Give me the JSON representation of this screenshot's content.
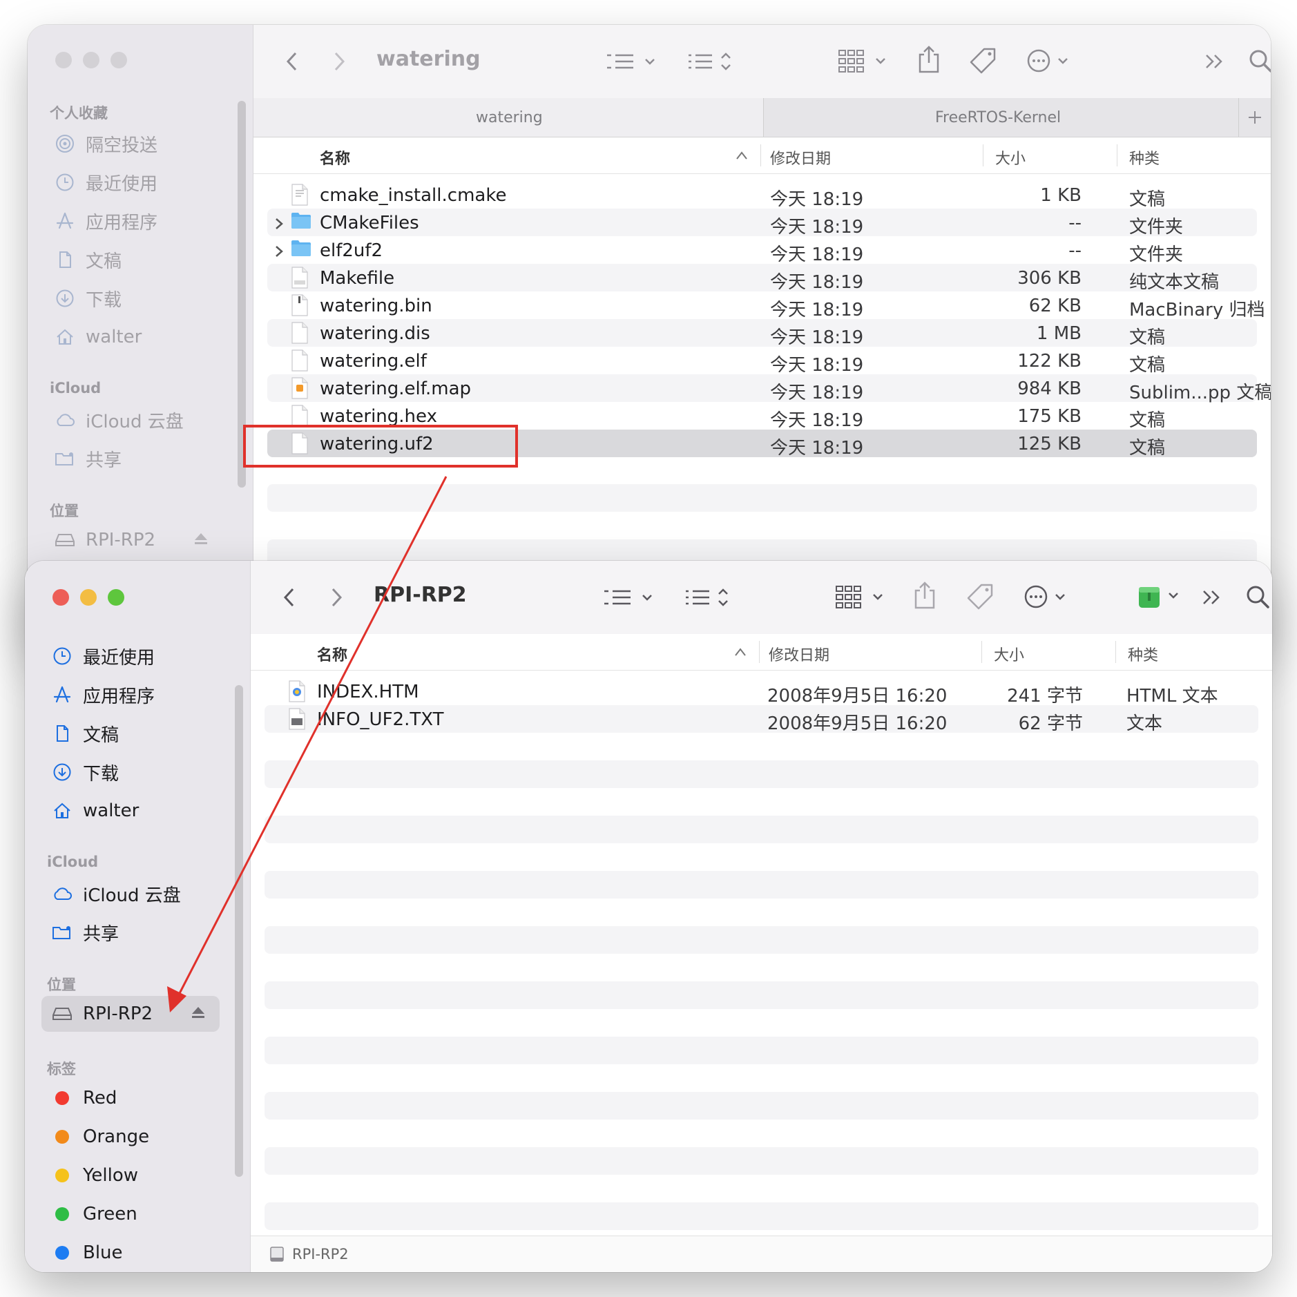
{
  "back_window": {
    "title": "watering",
    "sidebar": {
      "favorites_title": "个人收藏",
      "favorites": [
        {
          "icon": "airdrop-icon",
          "label": "隔空投送"
        },
        {
          "icon": "clock-icon",
          "label": "最近使用"
        },
        {
          "icon": "apps-icon",
          "label": "应用程序"
        },
        {
          "icon": "document-icon",
          "label": "文稿"
        },
        {
          "icon": "download-icon",
          "label": "下载"
        },
        {
          "icon": "home-icon",
          "label": "walter"
        }
      ],
      "icloud_title": "iCloud",
      "icloud": [
        {
          "icon": "cloud-icon",
          "label": "iCloud 云盘"
        },
        {
          "icon": "shared-folder-icon",
          "label": "共享"
        }
      ],
      "locations_title": "位置",
      "locations": [
        {
          "icon": "drive-icon",
          "label": "RPI-RP2"
        }
      ]
    },
    "tabs": [
      "watering",
      "FreeRTOS-Kernel"
    ],
    "columns": {
      "name": "名称",
      "date": "修改日期",
      "size": "大小",
      "kind": "种类"
    },
    "files": [
      {
        "name": "cmake_install.cmake",
        "date": "今天 18:19",
        "size": "1 KB",
        "kind": "文稿"
      },
      {
        "name": "CMakeFiles",
        "date": "今天 18:19",
        "size": "--",
        "kind": "文件夹"
      },
      {
        "name": "elf2uf2",
        "date": "今天 18:19",
        "size": "--",
        "kind": "文件夹"
      },
      {
        "name": "Makefile",
        "date": "今天 18:19",
        "size": "306 KB",
        "kind": "纯文本文稿"
      },
      {
        "name": "watering.bin",
        "date": "今天 18:19",
        "size": "62 KB",
        "kind": "MacBinary 归档"
      },
      {
        "name": "watering.dis",
        "date": "今天 18:19",
        "size": "1 MB",
        "kind": "文稿"
      },
      {
        "name": "watering.elf",
        "date": "今天 18:19",
        "size": "122 KB",
        "kind": "文稿"
      },
      {
        "name": "watering.elf.map",
        "date": "今天 18:19",
        "size": "984 KB",
        "kind": "Sublim...pp 文稿"
      },
      {
        "name": "watering.hex",
        "date": "今天 18:19",
        "size": "175 KB",
        "kind": "文稿"
      },
      {
        "name": "watering.uf2",
        "date": "今天 18:19",
        "size": "125 KB",
        "kind": "文稿"
      }
    ]
  },
  "front_window": {
    "title": "RPI-RP2",
    "sidebar": {
      "recents": [
        {
          "icon": "clock-icon",
          "label": "最近使用"
        },
        {
          "icon": "apps-icon",
          "label": "应用程序"
        },
        {
          "icon": "document-icon",
          "label": "文稿"
        },
        {
          "icon": "download-icon",
          "label": "下载"
        },
        {
          "icon": "home-icon",
          "label": "walter"
        }
      ],
      "icloud_title": "iCloud",
      "icloud": [
        {
          "icon": "cloud-icon",
          "label": "iCloud 云盘"
        },
        {
          "icon": "shared-folder-icon",
          "label": "共享"
        }
      ],
      "locations_title": "位置",
      "locations": [
        {
          "icon": "drive-icon",
          "label": "RPI-RP2"
        }
      ],
      "tags_title": "标签",
      "tags": [
        {
          "label": "Red",
          "color": "#f23a30"
        },
        {
          "label": "Orange",
          "color": "#f28a1a"
        },
        {
          "label": "Yellow",
          "color": "#f5c21b"
        },
        {
          "label": "Green",
          "color": "#2ebd45"
        },
        {
          "label": "Blue",
          "color": "#1d7cf2"
        }
      ]
    },
    "columns": {
      "name": "名称",
      "date": "修改日期",
      "size": "大小",
      "kind": "种类"
    },
    "files": [
      {
        "name": "INDEX.HTM",
        "date": "2008年9月5日 16:20",
        "size": "241 字节",
        "kind": "HTML 文本"
      },
      {
        "name": "INFO_UF2.TXT",
        "date": "2008年9月5日 16:20",
        "size": "62 字节",
        "kind": "文本"
      }
    ],
    "status_path": "RPI-RP2"
  },
  "colors": {
    "annotation": "#e0312b",
    "folder": "#5eb3f0",
    "accent": "#1d6fe0"
  }
}
